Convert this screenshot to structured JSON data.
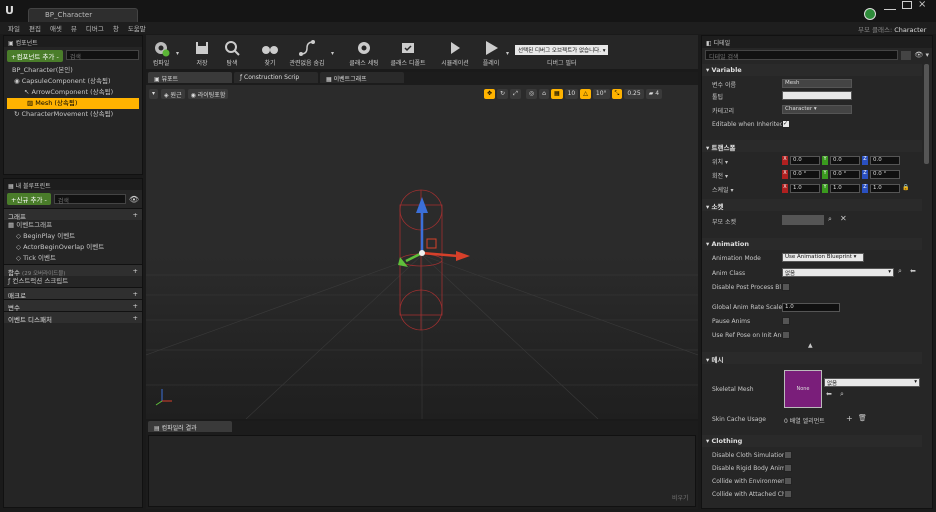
{
  "window": {
    "tab_title": "BP_Character",
    "parent_class_label": "부모 클래스:",
    "parent_class": "Character"
  },
  "menu": [
    "파일",
    "편집",
    "애셋",
    "뷰",
    "디버그",
    "창",
    "도움말"
  ],
  "components": {
    "tab": "컴포넌트",
    "add_button": "+컴포넌트 추가 -",
    "search_placeholder": "검색",
    "root": "BP_Character(본인)",
    "items": [
      "CapsuleComponent (상속됨)",
      "ArrowComponent (상속됨)",
      "Mesh (상속됨)",
      "CharacterMovement (상속됨)"
    ]
  },
  "myblueprint": {
    "tab": "내 블루프린트",
    "add_button": "+신규 추가 -",
    "search_placeholder": "검색",
    "graph_label": "그래프",
    "eventgraph": "이벤트그래프",
    "events": [
      "BeginPlay 이벤트",
      "ActorBeginOverlap 이벤트",
      "Tick 이벤트"
    ],
    "functions_label": "함수",
    "functions_count": "(29 오버라이드블)",
    "construction": "컨스트럭션 스크립트",
    "macros": "매크로",
    "variables": "변수",
    "dispatchers": "이벤트 디스패처"
  },
  "toolbar": {
    "compile": "컴파일",
    "save": "저장",
    "browse": "탐색",
    "find": "찾기",
    "hidden": "관련없음 숨김",
    "class_settings": "클래스 세팅",
    "class_defaults": "클래스 디폴트",
    "simulation": "시뮬레이션",
    "play": "플레이",
    "debug_select": "선택된 디버그 오브젝트가 없습니다.",
    "debug_filter": "디버그 필터"
  },
  "viewport": {
    "tabs": [
      "뷰포트",
      "Construction Scrip",
      "이벤트그래프"
    ],
    "perspective": "원근",
    "lit": "라이팅포함",
    "snap1": "10",
    "snap2": "10°",
    "snap3": "0.25",
    "snap4": "4"
  },
  "compiler": {
    "tab": "컴파일러 결과",
    "clear": "비우기"
  },
  "details": {
    "tab": "디테일",
    "search_placeholder": "디테일 검색",
    "variable": {
      "title": "Variable",
      "name_label": "변수 이름",
      "name": "Mesh",
      "tooltip_label": "툴팁",
      "category_label": "카테고리",
      "category": "Character",
      "editable": "Editable when Inherited"
    },
    "transform": {
      "title": "트랜스폼",
      "location": "위치",
      "rotation": "회전",
      "scale": "스케일",
      "loc": [
        "0.0",
        "0.0",
        "0.0"
      ],
      "rot": [
        "0.0 °",
        "0.0 °",
        "0.0 °"
      ],
      "scl": [
        "1.0",
        "1.0",
        "1.0"
      ]
    },
    "socket": {
      "title": "소켓",
      "parent_socket": "부모 소켓"
    },
    "animation": {
      "title": "Animation",
      "mode_label": "Animation Mode",
      "mode": "Use Animation Blueprint",
      "class_label": "Anim Class",
      "class": "없음",
      "disable_post": "Disable Post Process Bl",
      "rate_label": "Global Anim Rate Scale",
      "rate": "1.0",
      "pause": "Pause Anims",
      "ref_pose": "Use Ref Pose on Init Ani"
    },
    "mesh": {
      "title": "메시",
      "skeletal_label": "Skeletal Mesh",
      "thumb": "None",
      "value": "없음",
      "cache_label": "Skin Cache Usage",
      "cache_value": "0 배열 엘리먼트"
    },
    "clothing": {
      "title": "Clothing",
      "items": [
        "Disable Cloth Simulatior",
        "Disable Rigid Body Anim",
        "Collide with Environmen",
        "Collide with Attached Ch"
      ]
    }
  },
  "colors": {
    "accent": "#ffb300",
    "green": "#4a7d2a",
    "bg": "#252525"
  }
}
